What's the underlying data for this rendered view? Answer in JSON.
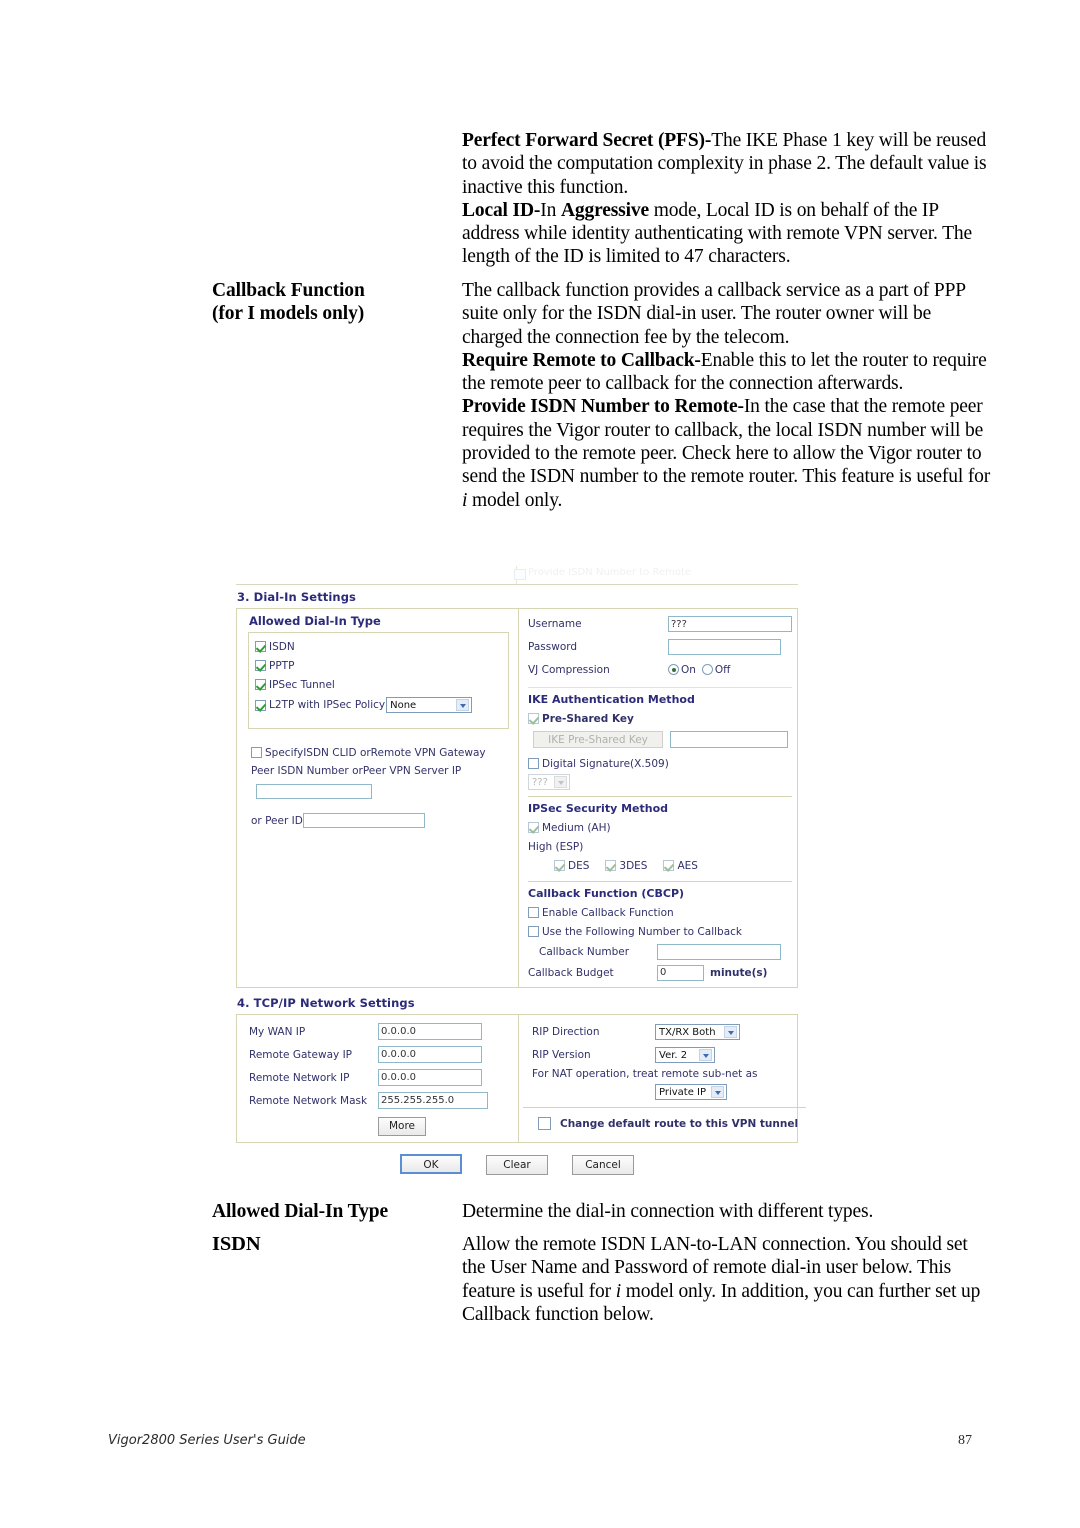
{
  "prose_top": [
    {
      "term": "",
      "html": "<b>Perfect Forward Secret (PFS)-</b>The IKE Phase 1 key will be reused to avoid the computation complexity in phase 2. The default value is inactive this function.<br><b>Local ID-</b>In <b>Aggressive</b> mode, Local ID is on behalf of the IP address while identity authenticating with remote VPN server. The length of the ID is limited to 47 characters."
    },
    {
      "term": "Callback Function",
      "term2": "(for I models only)",
      "html": "The callback function provides a callback service as a part of PPP suite only for the ISDN dial-in user. The router owner will be charged the connection fee by the telecom.<br><b>Require Remote to Callback-</b>Enable this to let the router to require the remote peer to callback for the connection afterwards.<br><b>Provide ISDN Number to Remote-</b>In the case that the remote peer requires the Vigor router to callback, the local ISDN number will be provided to the remote peer. Check here to allow the Vigor router to send the ISDN number to the remote router. This feature is useful for <i>i</i> model only."
    }
  ],
  "prose_bottom": [
    {
      "term": "Allowed Dial-In Type",
      "html": "Determine the dial-in connection with different types."
    },
    {
      "term": "ISDN",
      "html": "Allow the remote ISDN LAN-to-LAN connection. You should set the User Name and Password of remote dial-in user below. This feature is useful for <i>i</i> model only. In addition, you can further set up Callback function below."
    }
  ],
  "router_ui": {
    "ghost_row_text": "Provide ISDN Number to Remote",
    "section3": {
      "title": "3. Dial-In Settings",
      "left": {
        "subhead": "Allowed Dial-In Type",
        "dial_in_types": [
          {
            "label": "ISDN",
            "checked": true
          },
          {
            "label": "PPTP",
            "checked": true
          },
          {
            "label": "IPSec Tunnel",
            "checked": true
          },
          {
            "label": "L2TP with IPSec Policy",
            "checked": true,
            "select_value": "None"
          }
        ],
        "specify_clid_label": "SpecifyISDN CLID orRemote VPN Gateway",
        "specify_clid_checked": false,
        "peer_isdn_label": "Peer ISDN Number orPeer VPN Server IP",
        "peer_isdn_value": "",
        "or_peer_id_label": "or Peer ID",
        "or_peer_id_value": ""
      },
      "right": {
        "username_label": "Username",
        "username_value": "???",
        "password_label": "Password",
        "password_value": "",
        "vj_label": "VJ Compression",
        "vj_on_label": "On",
        "vj_off_label": "Off",
        "vj_selected": "On",
        "ike_head": "IKE Authentication Method",
        "preshared_key_label": "Pre-Shared Key",
        "preshared_key_checked": true,
        "ike_psk_button": "IKE Pre-Shared Key",
        "ike_psk_value": "",
        "digital_sig_label": "Digital Signature(X.509)",
        "digital_sig_checked": false,
        "digital_sig_select": "???",
        "ipsec_head": "IPSec Security Method",
        "medium_label": "Medium (AH)",
        "medium_checked": true,
        "high_label": "High (ESP)",
        "esp_options": [
          {
            "label": "DES",
            "checked": true
          },
          {
            "label": "3DES",
            "checked": true
          },
          {
            "label": "AES",
            "checked": true
          }
        ],
        "cbcp_head": "Callback Function (CBCP)",
        "enable_callback_label": "Enable Callback Function",
        "enable_callback_checked": false,
        "use_following_label": "Use the Following Number to Callback",
        "use_following_checked": false,
        "callback_number_label": "Callback Number",
        "callback_number_value": "",
        "callback_budget_label": "Callback Budget",
        "callback_budget_value": "0",
        "callback_budget_unit": "minute(s)"
      }
    },
    "section4": {
      "title": "4. TCP/IP Network Settings",
      "left_fields": [
        {
          "label": "My WAN IP",
          "value": "0.0.0.0"
        },
        {
          "label": "Remote Gateway IP",
          "value": "0.0.0.0"
        },
        {
          "label": "Remote Network IP",
          "value": "0.0.0.0"
        },
        {
          "label": "Remote Network Mask",
          "value": "255.255.255.0"
        }
      ],
      "more_button": "More",
      "right": {
        "rip_direction_label": "RIP Direction",
        "rip_direction_value": "TX/RX Both",
        "rip_version_label": "RIP Version",
        "rip_version_value": "Ver. 2",
        "nat_label": "For NAT operation, treat remote sub-net as",
        "nat_value": "Private IP",
        "change_route_label": "Change default route to this VPN tunnel",
        "change_route_checked": false
      }
    },
    "actions": {
      "ok": "OK",
      "clear": "Clear",
      "cancel": "Cancel"
    }
  },
  "footer": {
    "left": "Vigor2800 Series User's Guide",
    "page": "87"
  }
}
